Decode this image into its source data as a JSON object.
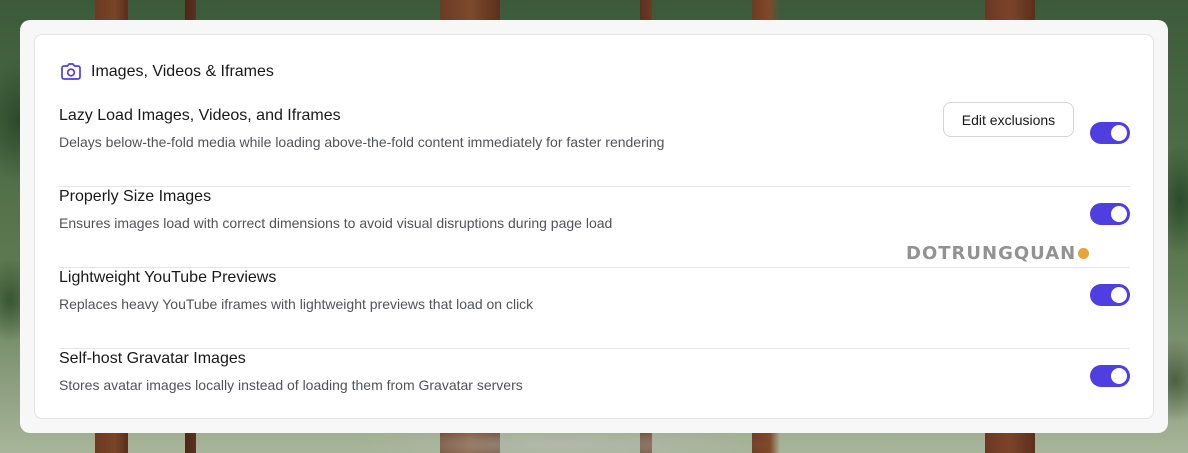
{
  "section": {
    "title": "Images, Videos & Iframes",
    "icon": "camera-icon",
    "accent_color": "#4f3ee0"
  },
  "settings": [
    {
      "title": "Lazy Load Images, Videos, and Iframes",
      "description": "Delays below-the-fold media while loading above-the-fold content immediately for faster rendering",
      "enabled": true,
      "action_label": "Edit exclusions"
    },
    {
      "title": "Properly Size Images",
      "description": "Ensures images load with correct dimensions to avoid visual disruptions during page load",
      "enabled": true
    },
    {
      "title": "Lightweight YouTube Previews",
      "description": "Replaces heavy YouTube iframes with lightweight previews that load on click",
      "enabled": true
    },
    {
      "title": "Self-host Gravatar Images",
      "description": "Stores avatar images locally instead of loading them from Gravatar servers",
      "enabled": true
    }
  ],
  "watermark": "DOTRUNGQUAN"
}
